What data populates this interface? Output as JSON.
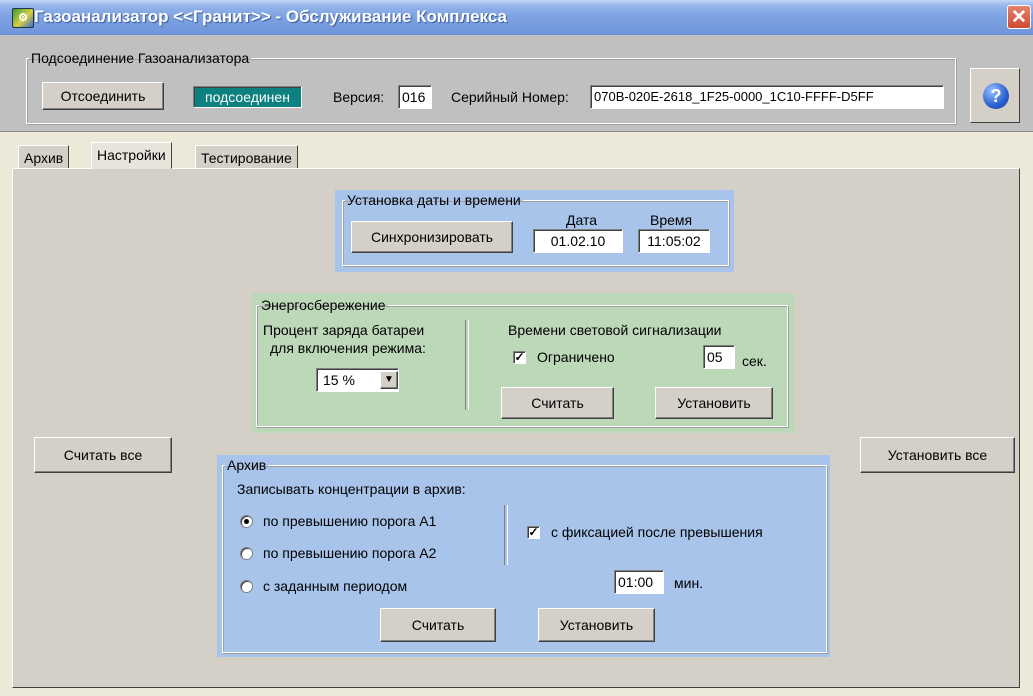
{
  "window": {
    "title": "Газоанализатор <<Гранит>> - Обслуживание Комплекса",
    "close_glyph": "✕"
  },
  "connection": {
    "group_title": "Подсоединение Газоанализатора",
    "disconnect_label": "Отсоединить",
    "status": "подсоединен",
    "version_label": "Версия:",
    "version_value": "016",
    "serial_label": "Серийный Номер:",
    "serial_value": "070B-020E-2618_1F25-0000_1C10-FFFF-D5FF",
    "help_glyph": "?"
  },
  "tabs": [
    {
      "label": "Архив",
      "active": false
    },
    {
      "label": "Настройки",
      "active": true
    },
    {
      "label": "Тестирование",
      "active": false
    }
  ],
  "datetime": {
    "group_title": "Установка даты и времени",
    "sync_label": "Синхронизировать",
    "date_label": "Дата",
    "date_value": "01.02.10",
    "time_label": "Время",
    "time_value": "11:05:02"
  },
  "energy": {
    "group_title": "Энергосбережение",
    "battery_label_line1": "Процент заряда батареи",
    "battery_label_line2": "для включения режима:",
    "battery_value": "15 %",
    "signal_title": "Времени световой сигнализации",
    "limited_label": "Ограничено",
    "limited_checked": true,
    "seconds_value": "05",
    "seconds_unit": "сек.",
    "read_label": "Считать",
    "set_label": "Установить"
  },
  "read_all_label": "Считать все",
  "set_all_label": "Установить все",
  "archive": {
    "group_title": "Архив",
    "heading": "Записывать концентрации в архив:",
    "options": [
      {
        "label": "по превышению порога А1",
        "selected": true
      },
      {
        "label": "по превышению порога А2",
        "selected": false
      },
      {
        "label": "с заданным периодом",
        "selected": false
      }
    ],
    "fix_label": "с фиксацией после превышения",
    "fix_checked": true,
    "period_value": "01:00",
    "period_unit": "мин.",
    "read_label": "Считать",
    "set_label": "Установить"
  },
  "colors": {
    "titlebar": "#7da2e2",
    "blue_panel": "#a8c4ea",
    "green_panel": "#bcd8b8",
    "status": "#0d8080"
  },
  "icons": {
    "app": "gas-analyzer-icon",
    "help": "help-icon",
    "dropdown": "chevron-down-icon"
  }
}
